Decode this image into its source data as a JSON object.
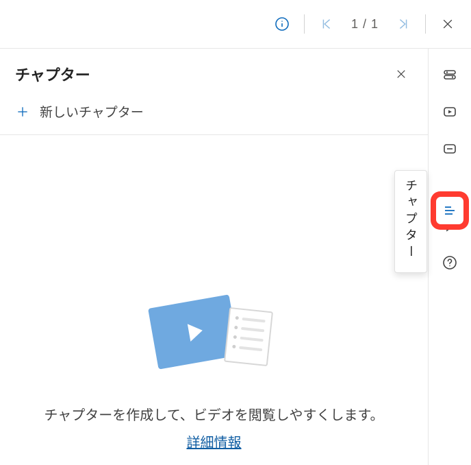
{
  "toolbar": {
    "page_count": "1 / 1"
  },
  "panel": {
    "title": "チャプター",
    "new_chapter_label": "新しいチャプター",
    "empty_message": "チャプターを作成して、ビデオを閲覧しやすくします。",
    "more_info": "詳細情報"
  },
  "tooltip": {
    "label": "チャプター"
  },
  "colors": {
    "accent": "#0f6cbd",
    "highlight": "#ff3b30",
    "link": "#115ea3"
  }
}
